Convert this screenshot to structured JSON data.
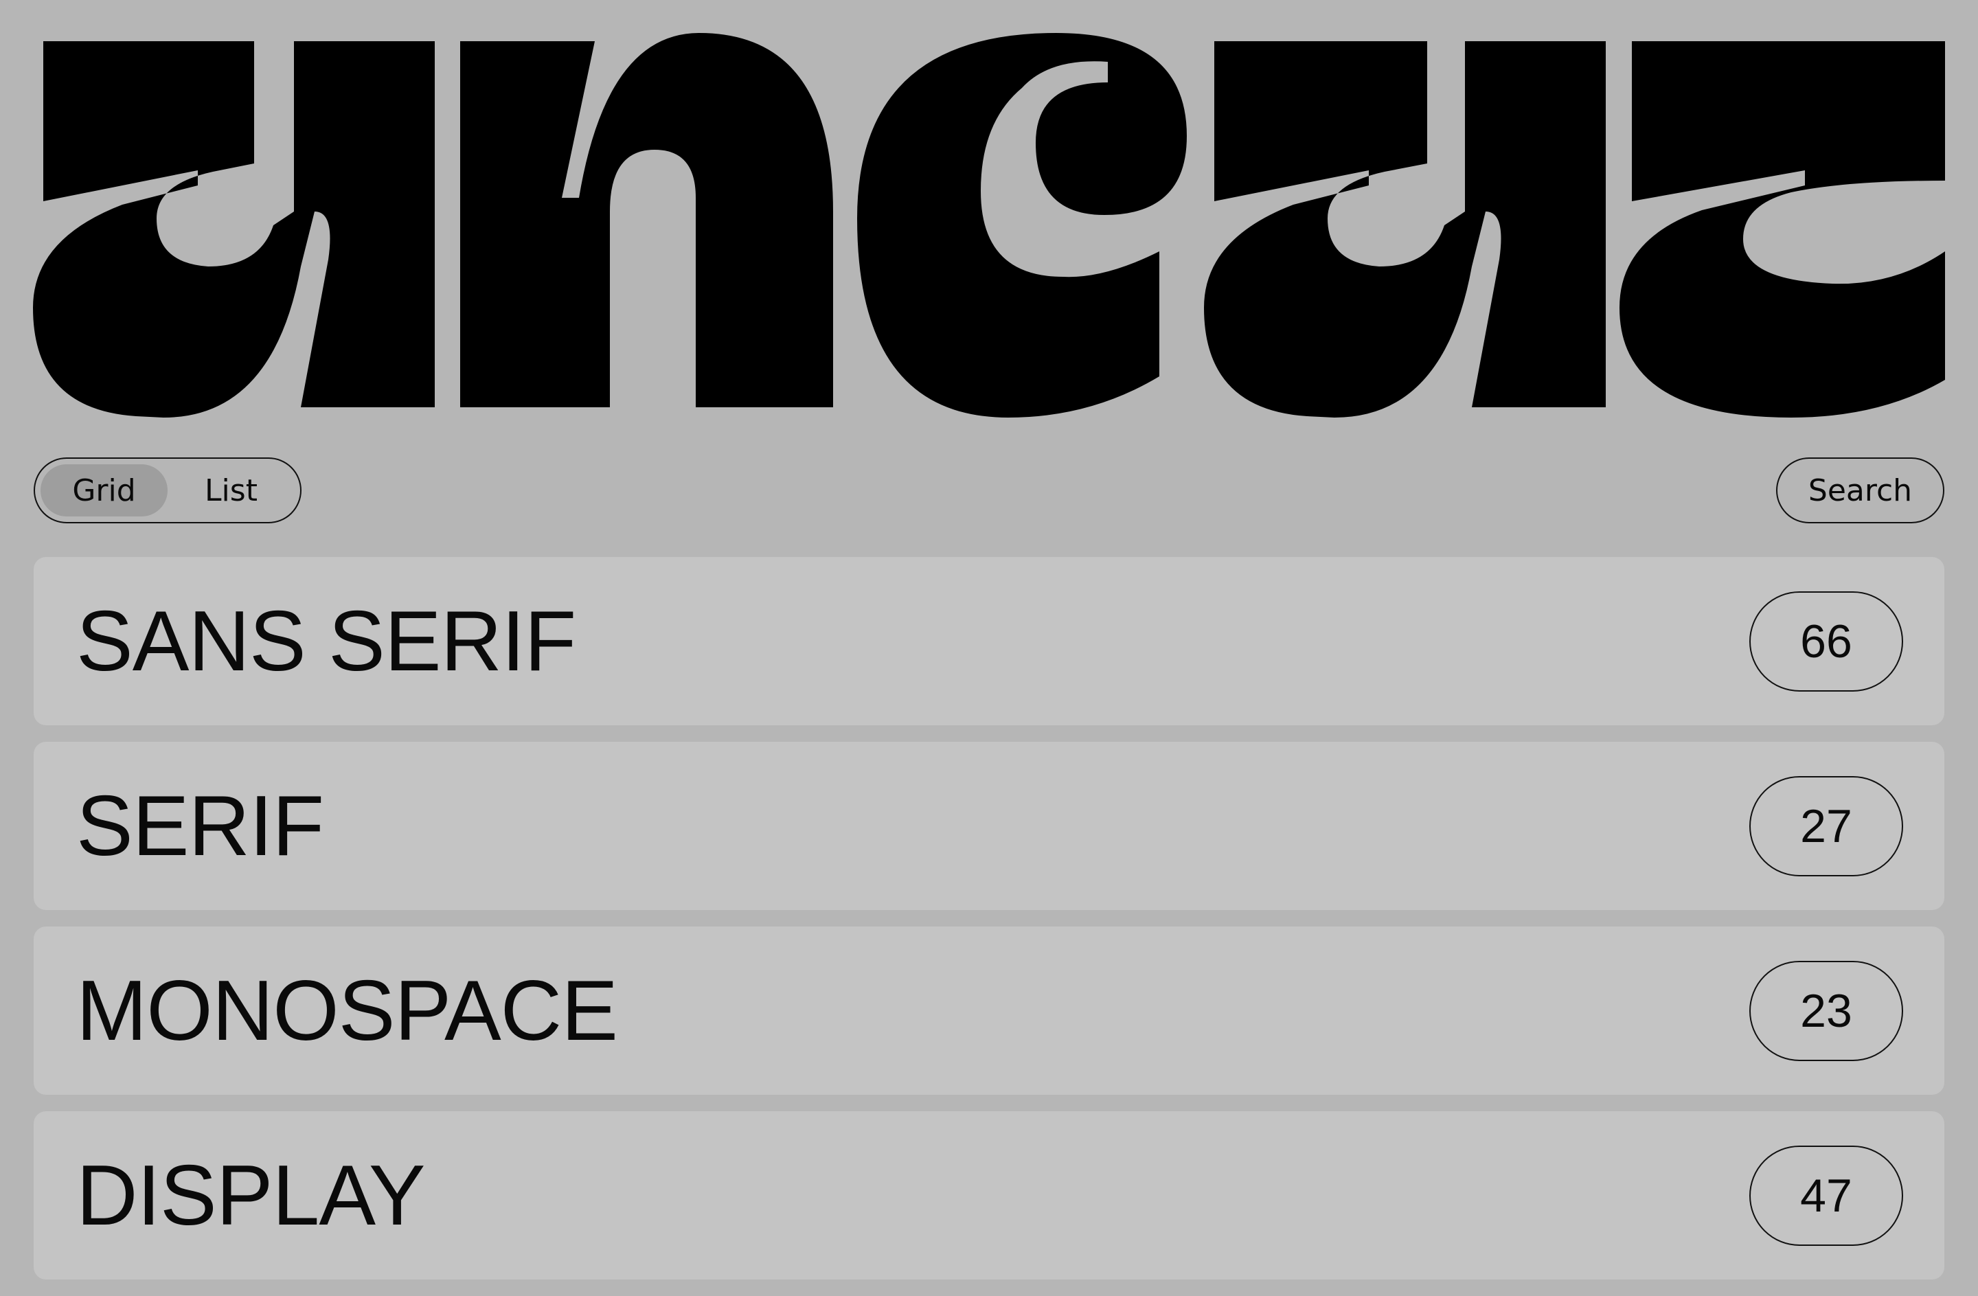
{
  "logo": {
    "text": "ancaz",
    "color": "#000000"
  },
  "toolbar": {
    "view_options": [
      {
        "label": "Grid",
        "selected": true
      },
      {
        "label": "List",
        "selected": false
      }
    ],
    "search_label": "Search"
  },
  "categories": [
    {
      "name": "SANS SERIF",
      "count": "66"
    },
    {
      "name": "SERIF",
      "count": "27"
    },
    {
      "name": "MONOSPACE",
      "count": "23"
    },
    {
      "name": "DISPLAY",
      "count": "47"
    }
  ],
  "colors": {
    "background": "#b6b6b6",
    "row": "#c4c4c4",
    "selected_toggle": "#9e9e9e",
    "text": "#0a0a0a"
  }
}
